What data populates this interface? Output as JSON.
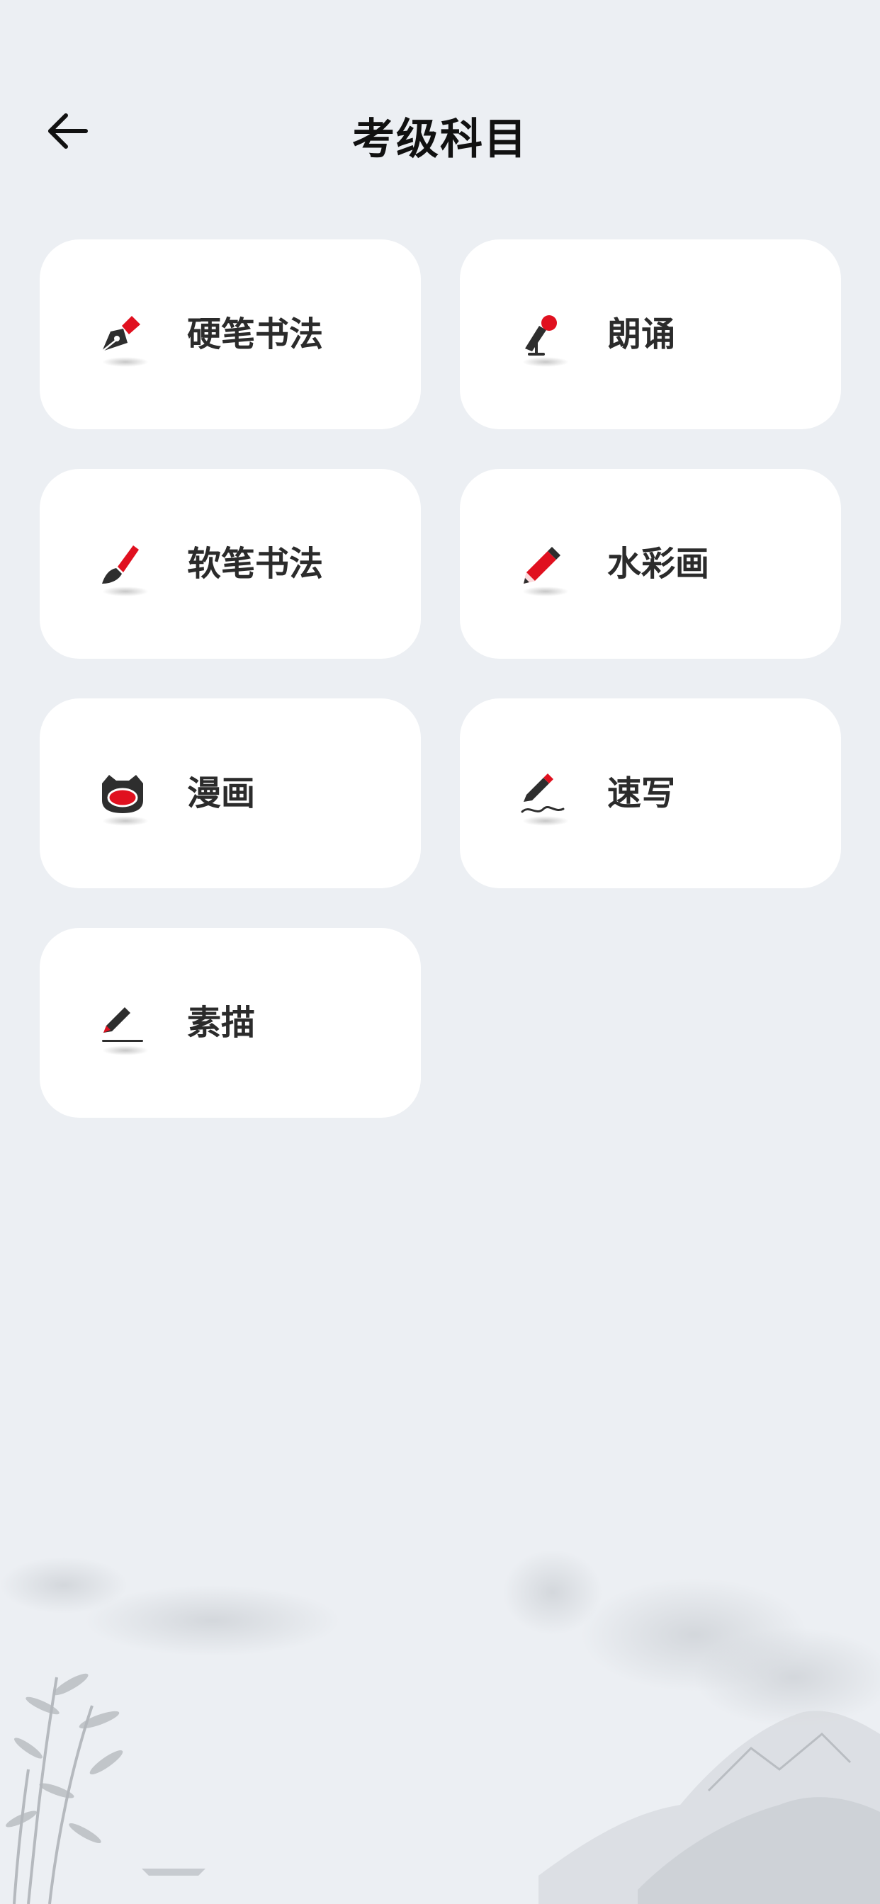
{
  "header": {
    "title": "考级科目"
  },
  "subjects": [
    {
      "label": "硬笔书法",
      "icon": "fountain-pen-icon"
    },
    {
      "label": "朗诵",
      "icon": "microphone-icon"
    },
    {
      "label": "软笔书法",
      "icon": "brush-icon"
    },
    {
      "label": "水彩画",
      "icon": "pencil-icon"
    },
    {
      "label": "漫画",
      "icon": "cartoon-cat-icon"
    },
    {
      "label": "速写",
      "icon": "sketch-pencil-icon"
    },
    {
      "label": "素描",
      "icon": "drawing-pencil-icon"
    }
  ],
  "colors": {
    "background": "#ECEFF3",
    "card": "#FFFFFF",
    "accent": "#E0101F",
    "icon_dark": "#2E2E2E",
    "text": "#2B2B2B"
  }
}
